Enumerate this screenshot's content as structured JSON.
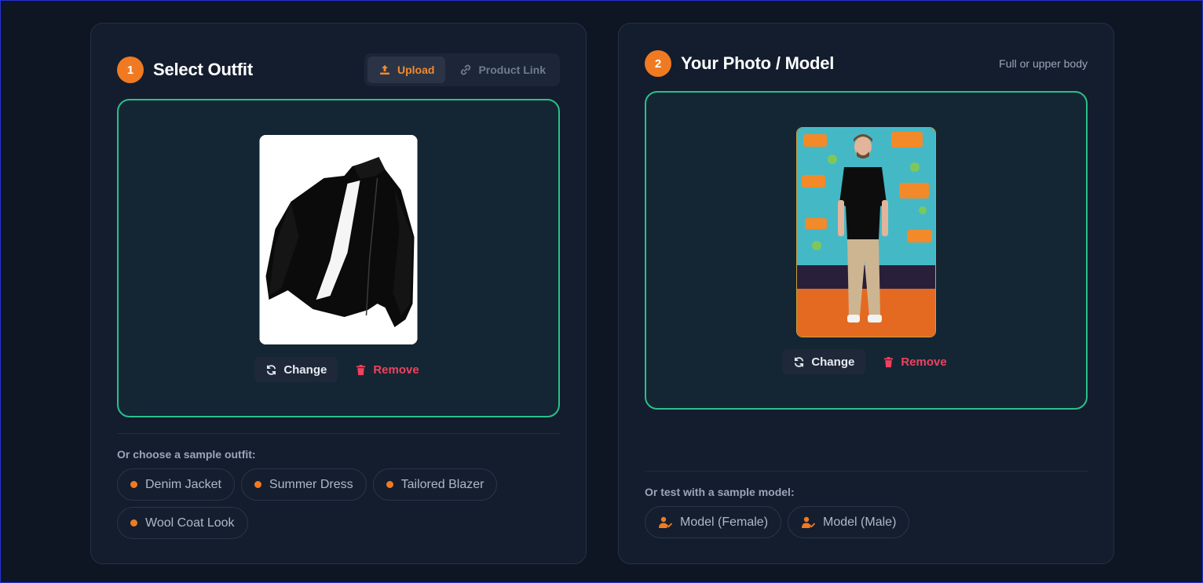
{
  "outfit": {
    "step": "1",
    "title": "Select Outfit",
    "tabs": {
      "upload": "Upload",
      "product_link": "Product Link"
    },
    "actions": {
      "change": "Change",
      "remove": "Remove"
    },
    "samples_label": "Or choose a sample outfit:",
    "samples": [
      "Denim Jacket",
      "Summer Dress",
      "Tailored Blazer",
      "Wool Coat Look"
    ]
  },
  "model": {
    "step": "2",
    "title": "Your Photo / Model",
    "hint": "Full or upper body",
    "actions": {
      "change": "Change",
      "remove": "Remove"
    },
    "samples_label": "Or test with a sample model:",
    "samples": [
      "Model (Female)",
      "Model (Male)"
    ]
  },
  "colors": {
    "accent": "#f07a22",
    "dropzone_border": "#2bbf8a",
    "remove": "#f0415e",
    "card_bg": "#131d2e",
    "page_bg": "#0e1624"
  },
  "icons": {
    "upload": "upload-icon",
    "link": "link-icon",
    "change": "refresh-icon",
    "remove": "trash-icon",
    "sample_model": "user-check-icon"
  }
}
